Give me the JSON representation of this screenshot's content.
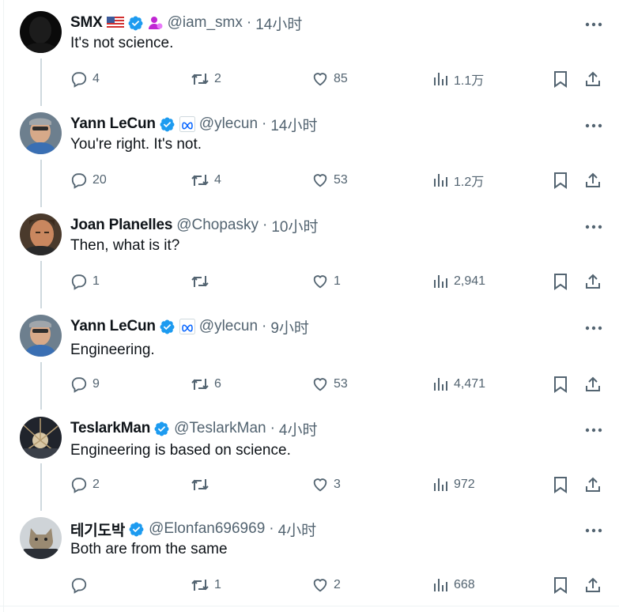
{
  "posts": [
    {
      "name": "SMX",
      "badges": [
        "us-flag-icon",
        "verified-icon",
        "affiliate-person-icon"
      ],
      "handle": "@iam_smx",
      "dot": "·",
      "time": "14小时",
      "text": "It's not science.",
      "replies": "4",
      "reposts": "2",
      "likes": "85",
      "views": "1.1万"
    },
    {
      "name": "Yann LeCun",
      "badges": [
        "verified-icon",
        "meta-affiliate-icon"
      ],
      "handle": "@ylecun",
      "dot": "·",
      "time": "14小时",
      "text": "You're right. It's not.",
      "replies": "20",
      "reposts": "4",
      "likes": "53",
      "views": "1.2万"
    },
    {
      "name": "Joan Planelles",
      "badges": [],
      "handle": "@Chopasky",
      "dot": "·",
      "time": "10小时",
      "text": "Then, what is it?",
      "replies": "1",
      "reposts": "",
      "likes": "1",
      "views": "2,941"
    },
    {
      "name": "Yann LeCun",
      "badges": [
        "verified-icon",
        "meta-affiliate-icon"
      ],
      "handle": "@ylecun",
      "dot": "·",
      "time": "9小时",
      "text": "Engineering.",
      "replies": "9",
      "reposts": "6",
      "likes": "53",
      "views": "4,471"
    },
    {
      "name": "TeslarkMan",
      "badges": [
        "verified-icon"
      ],
      "handle": "@TeslarkMan",
      "dot": "·",
      "time": "4小时",
      "text": "Engineering is based on science.",
      "replies": "2",
      "reposts": "",
      "likes": "3",
      "views": "972"
    },
    {
      "name": "테기도박",
      "badges": [
        "verified-icon"
      ],
      "handle": "@Elonfan696969",
      "dot": "·",
      "time": "4小时",
      "text": "Both are from the same",
      "replies": "",
      "reposts": "1",
      "likes": "2",
      "views": "668"
    }
  ],
  "colors": {
    "text": "#0f1419",
    "secondary": "#536471",
    "verified": "#1d9bf0",
    "thread_line": "#cfd9de",
    "affiliate_purple": "#c026d3"
  }
}
